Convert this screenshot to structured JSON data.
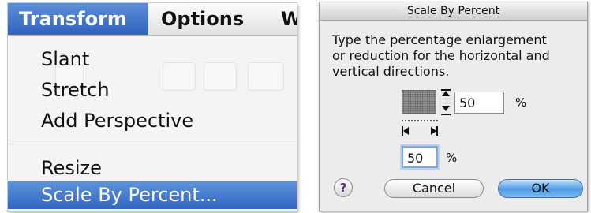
{
  "menu": {
    "menubar": {
      "items": [
        "Transform",
        "Options",
        "W"
      ],
      "active_item": "Transform"
    },
    "items": [
      {
        "label": "Slant",
        "selected": false
      },
      {
        "label": "Stretch",
        "selected": false
      },
      {
        "label": "Add Perspective",
        "selected": false
      },
      {
        "label": "Resize",
        "selected": false
      },
      {
        "label": "Scale By Percent...",
        "selected": true
      }
    ],
    "highlight_color": "#3a6fc6"
  },
  "dialog": {
    "title": "Scale By Percent",
    "prompt_lines": [
      "Type the percentage enlargement",
      "or reduction for the horizontal and",
      "vertical directions."
    ],
    "vertical_value": "50",
    "horizontal_value": "50",
    "percent_symbol": "%",
    "help_label": "?",
    "cancel_label": "Cancel",
    "ok_label": "OK",
    "default_button_color": "#4f9be6"
  }
}
